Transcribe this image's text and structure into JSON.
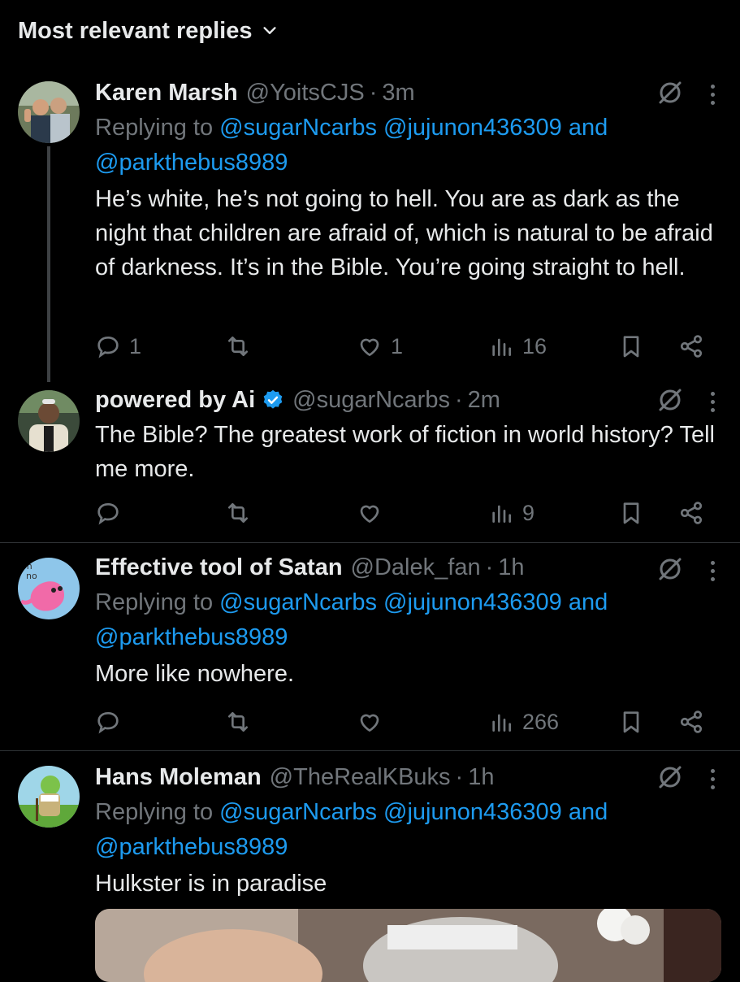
{
  "header": {
    "title": "Most relevant replies"
  },
  "tweets": [
    {
      "name": "Karen Marsh",
      "handle": "@YoitsCJS",
      "dot": "·",
      "time": "3m",
      "replying_prefix": "Replying to ",
      "mentions_line1": "@sugarNcarbs @jujunon436309",
      "and": " and",
      "mentions_line2": "@parkthebus8989",
      "text": "He’s white, he’s not going to hell. You are as dark as the night that children are afraid of, which is natural to be afraid of darkness. It’s in the Bible. You’re going straight to hell.",
      "replies": "1",
      "reposts": "",
      "likes": "1",
      "views": "16"
    },
    {
      "name": "powered by Ai",
      "verified": true,
      "handle": "@sugarNcarbs",
      "dot": "·",
      "time": "2m",
      "text": "The Bible? The greatest work of fiction in world history? Tell me more.",
      "replies": "",
      "reposts": "",
      "likes": "",
      "views": "9"
    },
    {
      "name": "Effective tool of Satan",
      "handle": "@Dalek_fan",
      "dot": "·",
      "time": "1h",
      "replying_prefix": "Replying to ",
      "mentions_line1": "@sugarNcarbs @jujunon436309",
      "and": " and",
      "mentions_line2": "@parkthebus8989",
      "text": "More like nowhere.",
      "replies": "",
      "reposts": "",
      "likes": "",
      "views": "266"
    },
    {
      "name": "Hans Moleman",
      "handle": "@TheRealKBuks",
      "dot": "·",
      "time": "1h",
      "replying_prefix": "Replying to ",
      "mentions_line1": "@sugarNcarbs @jujunon436309",
      "and": " and",
      "mentions_line2": "@parkthebus8989",
      "text": "Hulkster is in paradise"
    }
  ],
  "icons": {
    "header_chevron": "chevron-down-icon",
    "grok": "grok-icon",
    "more": "more-icon",
    "reply": "reply-icon",
    "repost": "repost-icon",
    "like": "like-icon",
    "views": "views-icon",
    "bookmark": "bookmark-icon",
    "share": "share-icon"
  },
  "colors": {
    "background": "#000000",
    "text": "#e7e9ea",
    "muted": "#71767b",
    "link": "#1d9bf0",
    "divider": "#2f3336"
  }
}
